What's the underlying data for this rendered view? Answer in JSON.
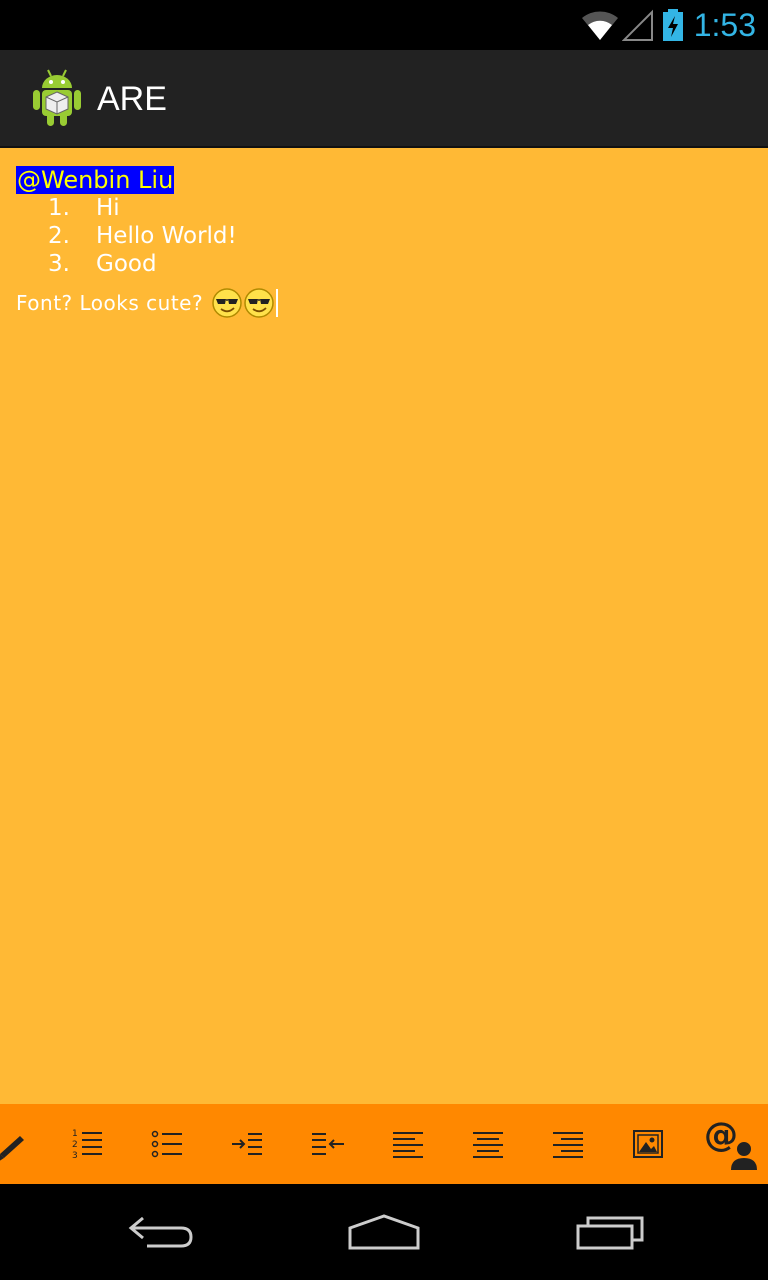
{
  "status_bar": {
    "time": "1:53",
    "icons": [
      "wifi-icon",
      "signal-icon",
      "battery-charging-icon"
    ],
    "time_color": "#33B5E5"
  },
  "action_bar": {
    "title": "ARE",
    "icon": "android-app-icon"
  },
  "editor": {
    "background": "#FFB935",
    "mention": "@Wenbin Liu",
    "list": [
      {
        "number": "1.",
        "text": "Hi"
      },
      {
        "number": "2.",
        "text": "Hello World!"
      },
      {
        "number": "3.",
        "text": "Good"
      }
    ],
    "font_line": "Font? Looks cute?",
    "emojis": [
      "cool-smiley-icon",
      "cool-smiley-icon"
    ]
  },
  "toolbar": {
    "background": "#FF8800",
    "tools": [
      "brush-icon",
      "numbered-list-icon",
      "bulleted-list-icon",
      "indent-right-icon",
      "indent-left-icon",
      "align-left-icon",
      "align-center-icon",
      "align-right-icon",
      "image-icon",
      "mention-user-icon"
    ]
  },
  "nav_bar": {
    "buttons": [
      "back-icon",
      "home-icon",
      "recents-icon"
    ]
  }
}
